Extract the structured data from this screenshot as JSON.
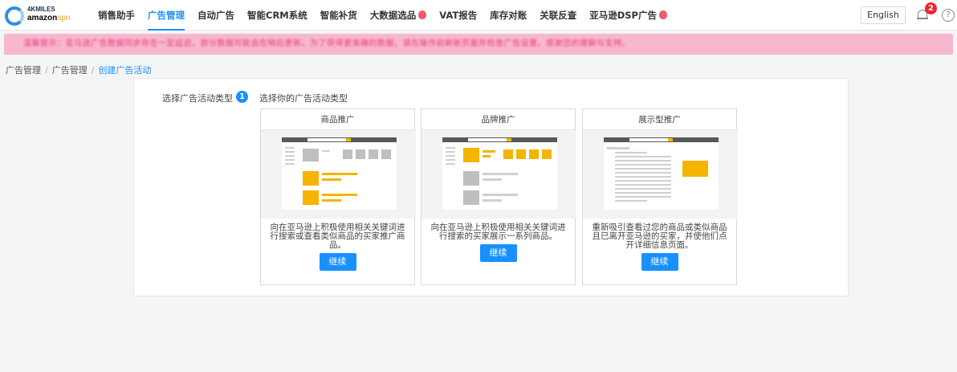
{
  "brand": {
    "line1": "4KMILES",
    "line2_main": "amazon",
    "line2_accent": "spn"
  },
  "nav": [
    {
      "label": "销售助手",
      "active": false,
      "hot": false
    },
    {
      "label": "广告管理",
      "active": true,
      "hot": false
    },
    {
      "label": "自动广告",
      "active": false,
      "hot": false
    },
    {
      "label": "智能CRM系统",
      "active": false,
      "hot": false
    },
    {
      "label": "智能补货",
      "active": false,
      "hot": false
    },
    {
      "label": "大数据选品",
      "active": false,
      "hot": true
    },
    {
      "label": "VAT报告",
      "active": false,
      "hot": false
    },
    {
      "label": "库存对账",
      "active": false,
      "hot": false
    },
    {
      "label": "关联反查",
      "active": false,
      "hot": false
    },
    {
      "label": "亚马逊DSP广告",
      "active": false,
      "hot": true
    }
  ],
  "header": {
    "language": "English",
    "notification_count": "2"
  },
  "notice": {
    "text": "温馨提示：亚马逊广告数据同步存在一定延迟，部分数据可能会在稍后更新。为了获得更准确的数据，请在操作前刷新页面并检查广告设置。感谢您的理解与支持。"
  },
  "breadcrumb": {
    "items": [
      "广告管理",
      "广告管理"
    ],
    "current": "创建广告活动"
  },
  "step": {
    "label": "选择广告活动类型",
    "number": "1",
    "title": "选择你的广告活动类型"
  },
  "cards": [
    {
      "title": "商品推广",
      "description": "向在亚马逊上积极使用相关关键词进行搜索或查看类似商品的买家推广商品。",
      "button": "继续"
    },
    {
      "title": "品牌推广",
      "description": "向在亚马逊上积极使用相关关键词进行搜索的买家展示一系列商品。",
      "button": "继续"
    },
    {
      "title": "展示型推广",
      "description": "重新吸引查看过您的商品或类似商品且已离开亚马逊的买家，并使他们点开详细信息页面。",
      "button": "继续"
    }
  ],
  "colors": {
    "accent": "#1890ff",
    "notice_bg": "#f7b8cf",
    "highlight": "#f5b400"
  }
}
